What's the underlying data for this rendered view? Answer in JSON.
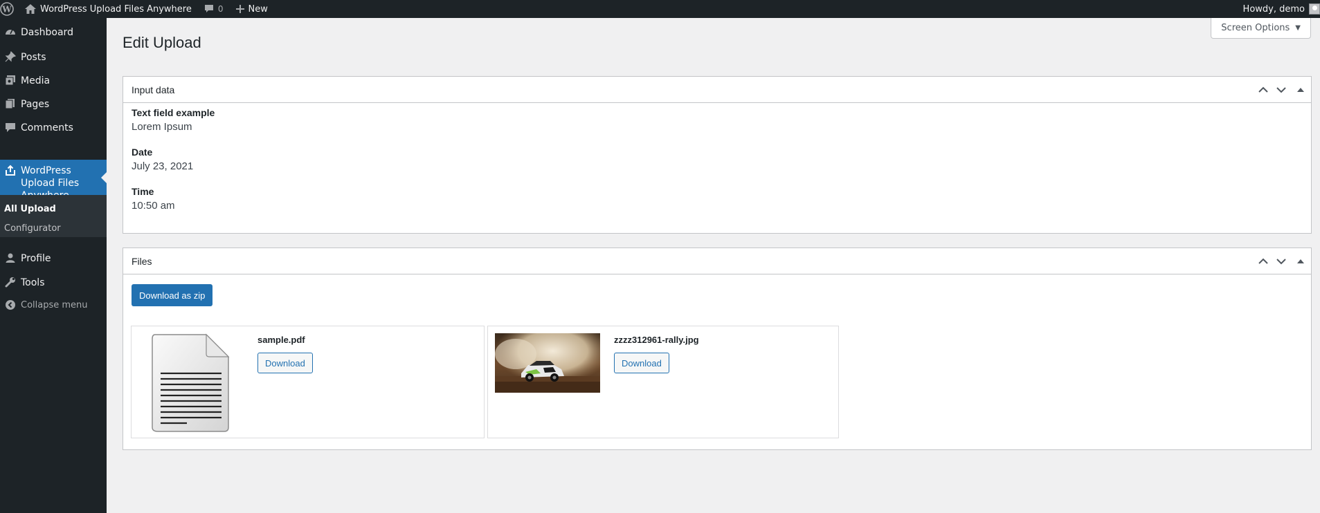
{
  "adminbar": {
    "site_name": "WordPress Upload Files Anywhere",
    "comments_count": "0",
    "new_label": "New",
    "howdy": "Howdy, demo"
  },
  "sidebar": {
    "items": [
      {
        "label": "Dashboard",
        "icon": "dashboard-icon"
      },
      {
        "label": "Posts",
        "icon": "pin-icon"
      },
      {
        "label": "Media",
        "icon": "media-icon"
      },
      {
        "label": "Pages",
        "icon": "pages-icon"
      },
      {
        "label": "Comments",
        "icon": "comment-icon"
      },
      {
        "label": "WordPress Upload Files Anywhere",
        "icon": "upload-icon"
      }
    ],
    "submenu": [
      "All Upload",
      "Configurator"
    ],
    "items_after": [
      {
        "label": "Profile",
        "icon": "user-icon"
      },
      {
        "label": "Tools",
        "icon": "wrench-icon"
      }
    ],
    "collapse_label": "Collapse menu"
  },
  "page": {
    "title": "Edit Upload",
    "screen_options": "Screen Options"
  },
  "input_box": {
    "title": "Input data",
    "fields": [
      {
        "label": "Text field example",
        "value": "Lorem Ipsum"
      },
      {
        "label": "Date",
        "value": "July 23, 2021"
      },
      {
        "label": "Time",
        "value": "10:50 am"
      }
    ]
  },
  "files_box": {
    "title": "Files",
    "zip_button": "Download as zip",
    "files": [
      {
        "name": "sample.pdf",
        "button": "Download",
        "thumbnail": "document-icon"
      },
      {
        "name": "zzzz312961-rally.jpg",
        "button": "Download",
        "thumbnail": "rally-car-photo"
      }
    ]
  },
  "colors": {
    "adminbar_bg": "#1d2327",
    "accent": "#2271b1",
    "body_bg": "#f0f0f1"
  }
}
